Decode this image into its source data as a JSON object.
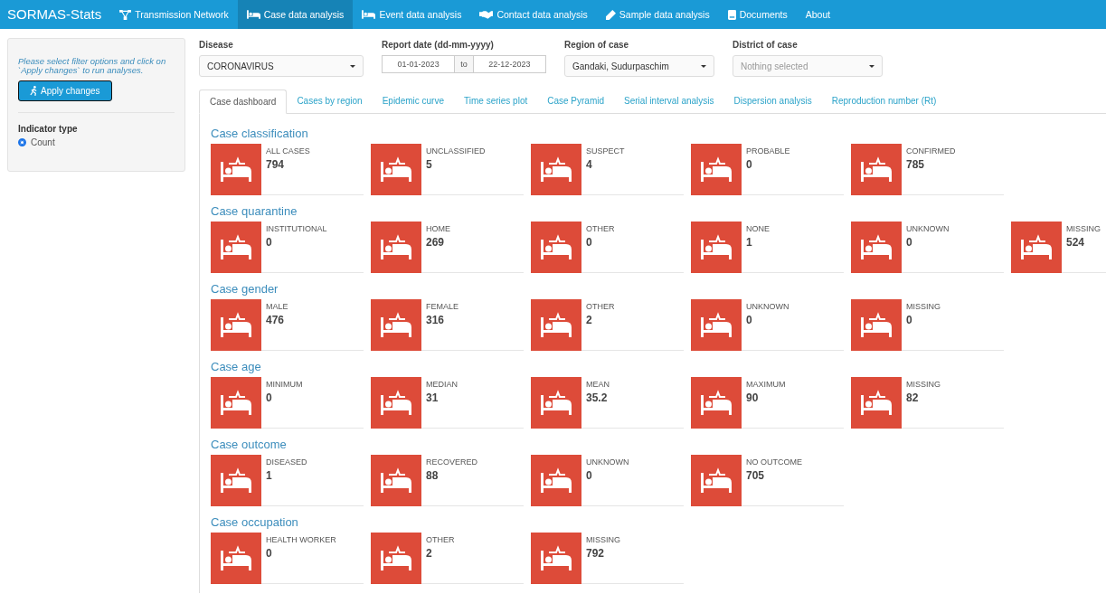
{
  "navbar": {
    "brand": "SORMAS-Stats",
    "items": [
      {
        "label": "Transmission Network",
        "kind": "network",
        "selected": false
      },
      {
        "label": "Case data analysis",
        "kind": "bed",
        "selected": true
      },
      {
        "label": "Event data analysis",
        "kind": "bed",
        "selected": false
      },
      {
        "label": "Contact data analysis",
        "kind": "handshake",
        "selected": false
      },
      {
        "label": "Sample data analysis",
        "kind": "pencil",
        "selected": false
      },
      {
        "label": "Documents",
        "kind": "book",
        "selected": false
      },
      {
        "label": "About",
        "selected": false
      }
    ]
  },
  "sidebar": {
    "help_text": "Please select filter options and click on `Apply changes` to run analyses.",
    "apply_button": "Apply changes",
    "indicator_label": "Indicator type",
    "indicator_options": [
      {
        "label": "Count",
        "selected": true
      }
    ]
  },
  "filters": {
    "disease": {
      "label": "Disease",
      "value": "CORONAVIRUS"
    },
    "report_date": {
      "label": "Report date (dd-mm-yyyy)",
      "from": "01-01-2023",
      "separator": "to",
      "to": "22-12-2023"
    },
    "region": {
      "label": "Region of case",
      "value": "Gandaki, Sudurpaschim"
    },
    "district": {
      "label": "District of case",
      "placeholder": "Nothing selected"
    }
  },
  "tabs": [
    {
      "label": "Case dashboard",
      "selected": true
    },
    {
      "label": "Cases by region",
      "selected": false
    },
    {
      "label": "Epidemic curve",
      "selected": false
    },
    {
      "label": "Time series plot",
      "selected": false
    },
    {
      "label": "Case Pyramid",
      "selected": false
    },
    {
      "label": "Serial interval analysis",
      "selected": false
    },
    {
      "label": "Dispersion analysis",
      "selected": false
    },
    {
      "label": "Reproduction number (Rt)",
      "selected": false
    }
  ],
  "sections": [
    {
      "title": "Case classification",
      "cards": [
        {
          "label": "ALL CASES",
          "value": "794"
        },
        {
          "label": "UNCLASSIFIED",
          "value": "5"
        },
        {
          "label": "SUSPECT",
          "value": "4"
        },
        {
          "label": "PROBABLE",
          "value": "0"
        },
        {
          "label": "CONFIRMED",
          "value": "785"
        }
      ]
    },
    {
      "title": "Case quarantine",
      "cards": [
        {
          "label": "INSTITUTIONAL",
          "value": "0"
        },
        {
          "label": "HOME",
          "value": "269"
        },
        {
          "label": "OTHER",
          "value": "0"
        },
        {
          "label": "NONE",
          "value": "1"
        },
        {
          "label": "UNKNOWN",
          "value": "0"
        },
        {
          "label": "MISSING",
          "value": "524"
        }
      ]
    },
    {
      "title": "Case gender",
      "cards": [
        {
          "label": "MALE",
          "value": "476"
        },
        {
          "label": "FEMALE",
          "value": "316"
        },
        {
          "label": "OTHER",
          "value": "2"
        },
        {
          "label": "UNKNOWN",
          "value": "0"
        },
        {
          "label": "MISSING",
          "value": "0"
        }
      ]
    },
    {
      "title": "Case age",
      "cards": [
        {
          "label": "MINIMUM",
          "value": "0"
        },
        {
          "label": "MEDIAN",
          "value": "31"
        },
        {
          "label": "MEAN",
          "value": "35.2"
        },
        {
          "label": "MAXIMUM",
          "value": "90"
        },
        {
          "label": "MISSING",
          "value": "82"
        }
      ]
    },
    {
      "title": "Case outcome",
      "cards": [
        {
          "label": "DISEASED",
          "value": "1"
        },
        {
          "label": "RECOVERED",
          "value": "88"
        },
        {
          "label": "UNKNOWN",
          "value": "0"
        },
        {
          "label": "NO OUTCOME",
          "value": "705"
        }
      ]
    },
    {
      "title": "Case occupation",
      "cards": [
        {
          "label": "HEALTH WORKER",
          "value": "0"
        },
        {
          "label": "OTHER",
          "value": "2"
        },
        {
          "label": "MISSING",
          "value": "792"
        }
      ]
    }
  ]
}
